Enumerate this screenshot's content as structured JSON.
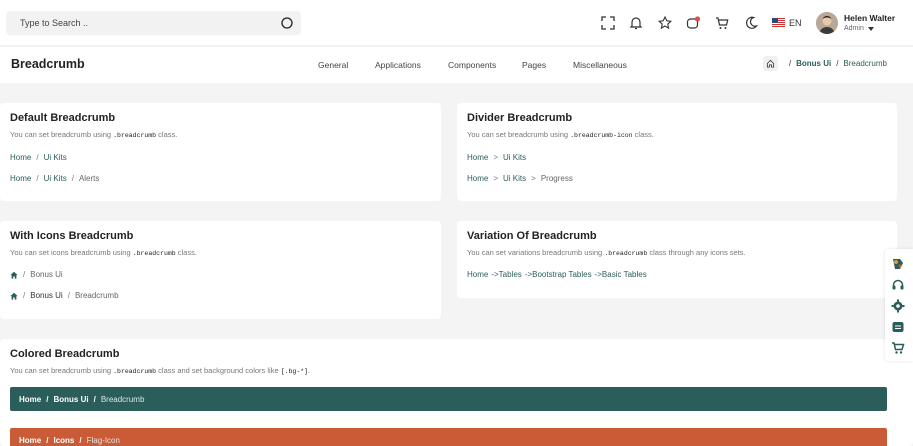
{
  "header": {
    "search_placeholder": "Type to Search ..",
    "language": "EN",
    "user": {
      "name": "Helen Walter",
      "role": "Admin"
    }
  },
  "subheader": {
    "title": "Breadcrumb",
    "nav": [
      "General",
      "Applications",
      "Components",
      "Pages",
      "Miscellaneous"
    ],
    "breadcrumb": [
      "Bonus Ui",
      "Breadcrumb"
    ]
  },
  "cards": {
    "default": {
      "title": "Default Breadcrumb",
      "desc_pre": "You can set breadcrumb using",
      "desc_code": ".breadcrumb",
      "desc_post": "class.",
      "row1": [
        "Home",
        "Ui Kits"
      ],
      "row2": [
        "Home",
        "Ui Kits",
        "Alerts"
      ]
    },
    "divider": {
      "title": "Divider Breadcrumb",
      "desc_pre": "You can set breadcrumb using",
      "desc_code": ".breadcrumb-icon",
      "desc_post": "class.",
      "row1": [
        "Home",
        "Ui Kits"
      ],
      "row2": [
        "Home",
        "Ui Kits",
        "Progress"
      ],
      "sep": ">"
    },
    "icons": {
      "title": "With Icons Breadcrumb",
      "desc_pre": "You can set icons breadcrumb using",
      "desc_code": ".breadcrumb",
      "desc_post": "class.",
      "row1": [
        "Bonus Ui"
      ],
      "row2": [
        "Bonus Ui",
        "Breadcrumb"
      ]
    },
    "variation": {
      "title": "Variation Of Breadcrumb",
      "desc_pre": "You can set variations breadcrumb using",
      "desc_code": ".breadcrumb",
      "desc_post": "class through any icons sets.",
      "row1": [
        "Home",
        "->Tables",
        "->Bootstrap Tables",
        "->Basic Tables"
      ]
    },
    "colored": {
      "title": "Colored Breadcrumb",
      "desc_pre": "You can set breadcrumb using",
      "desc_code": ".breadcrumb",
      "desc_mid": "class and set background colors like",
      "desc_code2": "[.bg-*]",
      "desc_post": ".",
      "bar1": [
        "Home",
        "Bonus Ui",
        "Breadcrumb"
      ],
      "bar2": [
        "Home",
        "Icons",
        "Flag-Icon"
      ]
    }
  },
  "colors": {
    "primary": "#2b5e5b",
    "secondary": "#c95b36",
    "badge_red": "#e14a4a"
  },
  "sep": "/"
}
